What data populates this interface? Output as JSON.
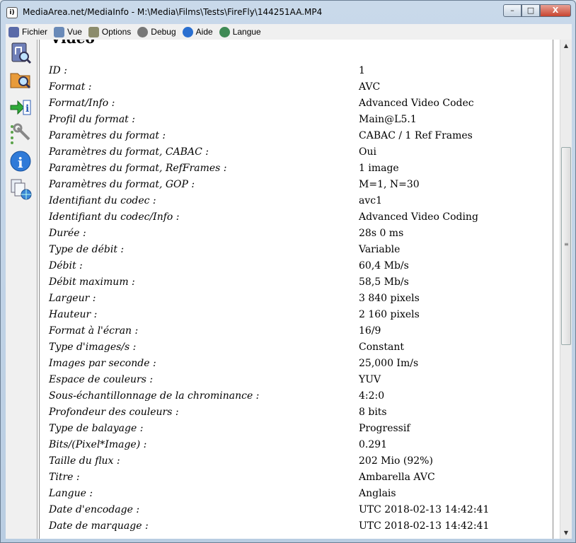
{
  "window": {
    "title": "MediaArea.net/MediaInfo - M:\\Media\\Films\\Tests\\FireFly\\144251AA.MP4",
    "icon_text": "i)",
    "controls": {
      "minimize": "–",
      "maximize": "□",
      "close": "X"
    }
  },
  "menu": [
    {
      "label": "Fichier",
      "icon": "file-wrench-icon",
      "color": "#5a6aa8"
    },
    {
      "label": "Vue",
      "icon": "view-icon",
      "color": "#6a8ab8"
    },
    {
      "label": "Options",
      "icon": "options-icon",
      "color": "#8c8c6c"
    },
    {
      "label": "Debug",
      "icon": "debug-gear-icon",
      "color": "#777777"
    },
    {
      "label": "Aide",
      "icon": "help-icon",
      "color": "#2a6fd0"
    },
    {
      "label": "Langue",
      "icon": "globe-icon",
      "color": "#3f8a55"
    }
  ],
  "toolbar": [
    {
      "icon": "open-file-icon"
    },
    {
      "icon": "open-folder-icon"
    },
    {
      "icon": "export-icon"
    },
    {
      "icon": "preferences-icon"
    },
    {
      "icon": "about-icon"
    },
    {
      "icon": "copy-web-icon"
    }
  ],
  "section": {
    "title": "Vidéo"
  },
  "rows": [
    {
      "label": "ID :",
      "value": "1"
    },
    {
      "label": "Format :",
      "value": "AVC"
    },
    {
      "label": "Format/Info :",
      "value": "Advanced Video Codec"
    },
    {
      "label": "Profil du format :",
      "value": "Main@L5.1"
    },
    {
      "label": "Paramètres du format :",
      "value": "CABAC / 1 Ref Frames"
    },
    {
      "label": "Paramètres du format, CABAC :",
      "value": "Oui"
    },
    {
      "label": "Paramètres du format, RefFrames :",
      "value": "1 image"
    },
    {
      "label": "Paramètres du format, GOP :",
      "value": "M=1, N=30"
    },
    {
      "label": "Identifiant du codec :",
      "value": "avc1"
    },
    {
      "label": "Identifiant du codec/Info :",
      "value": "Advanced Video Coding"
    },
    {
      "label": "Durée :",
      "value": "28s 0 ms"
    },
    {
      "label": "Type de débit :",
      "value": "Variable"
    },
    {
      "label": "Débit :",
      "value": "60,4 Mb/s"
    },
    {
      "label": "Débit maximum :",
      "value": "58,5 Mb/s"
    },
    {
      "label": "Largeur :",
      "value": "3 840 pixels"
    },
    {
      "label": "Hauteur :",
      "value": "2 160 pixels"
    },
    {
      "label": "Format à l'écran :",
      "value": "16/9"
    },
    {
      "label": "Type d'images/s :",
      "value": "Constant"
    },
    {
      "label": "Images par seconde :",
      "value": "25,000 Im/s"
    },
    {
      "label": "Espace de couleurs :",
      "value": "YUV"
    },
    {
      "label": "Sous-échantillonnage de la chrominance :",
      "value": "4:2:0"
    },
    {
      "label": "Profondeur des couleurs :",
      "value": "8 bits"
    },
    {
      "label": "Type de balayage :",
      "value": "Progressif"
    },
    {
      "label": "Bits/(Pixel*Image) :",
      "value": "0.291"
    },
    {
      "label": "Taille du flux :",
      "value": "202 Mio (92%)"
    },
    {
      "label": "Titre :",
      "value": "Ambarella AVC"
    },
    {
      "label": "Langue :",
      "value": "Anglais"
    },
    {
      "label": "Date d'encodage :",
      "value": "UTC 2018-02-13 14:42:41"
    },
    {
      "label": "Date de marquage :",
      "value": "UTC 2018-02-13 14:42:41"
    }
  ],
  "scrollbar": {
    "up": "▲",
    "down": "▼",
    "grip": "≡"
  }
}
